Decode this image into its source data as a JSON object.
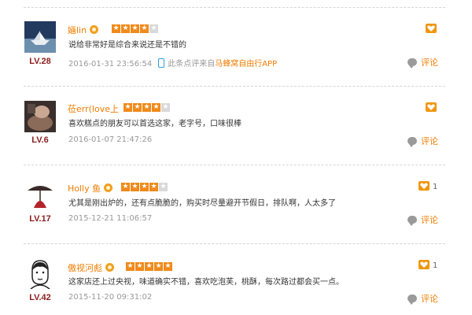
{
  "reviews": [
    {
      "username": "婳lin",
      "level": "LV.28",
      "rating": 4,
      "content": "说给非常好是综合来说还是不错的",
      "date": "2016-01-31 23:56:54",
      "source_text": "此条点评来自",
      "source_link": "马蜂窝自由行APP",
      "like_count": "",
      "comment_label": "评论",
      "avatar_icon": "paper-boat-avatar"
    },
    {
      "username": "莅err(love上",
      "level": "LV.6",
      "rating": 4,
      "content": "喜欢糕点的朋友可以首选这家，老字号，口味很棒",
      "date": "2016-01-07 21:47:26",
      "source_text": "",
      "source_link": "",
      "like_count": "",
      "comment_label": "评论",
      "avatar_icon": "hands-avatar"
    },
    {
      "username": "Holly 鱼",
      "level": "LV.17",
      "rating": 4,
      "content": "尤其是刚出炉的，还有点脆脆的，购买时尽量避开节假日，排队啊，人太多了",
      "date": "2015-12-21 11:06:57",
      "source_text": "",
      "source_link": "",
      "like_count": "1",
      "comment_label": "评论",
      "avatar_icon": "parasol-figure-avatar"
    },
    {
      "username": "傲视河彪",
      "level": "LV.42",
      "rating": 5,
      "content": "这家店还上过央视，味道确实不错，喜欢吃泡芙，桃酥，每次路过都会买一点。",
      "date": "2015-11-20 09:31:02",
      "source_text": "",
      "source_link": "",
      "like_count": "1",
      "comment_label": "评论",
      "avatar_icon": "cartoon-man-avatar"
    }
  ],
  "colors": {
    "accent": "#f07d00",
    "star_on": "#f08a1a",
    "star_off": "#d9d9d9",
    "level": "#8b1d1d"
  }
}
